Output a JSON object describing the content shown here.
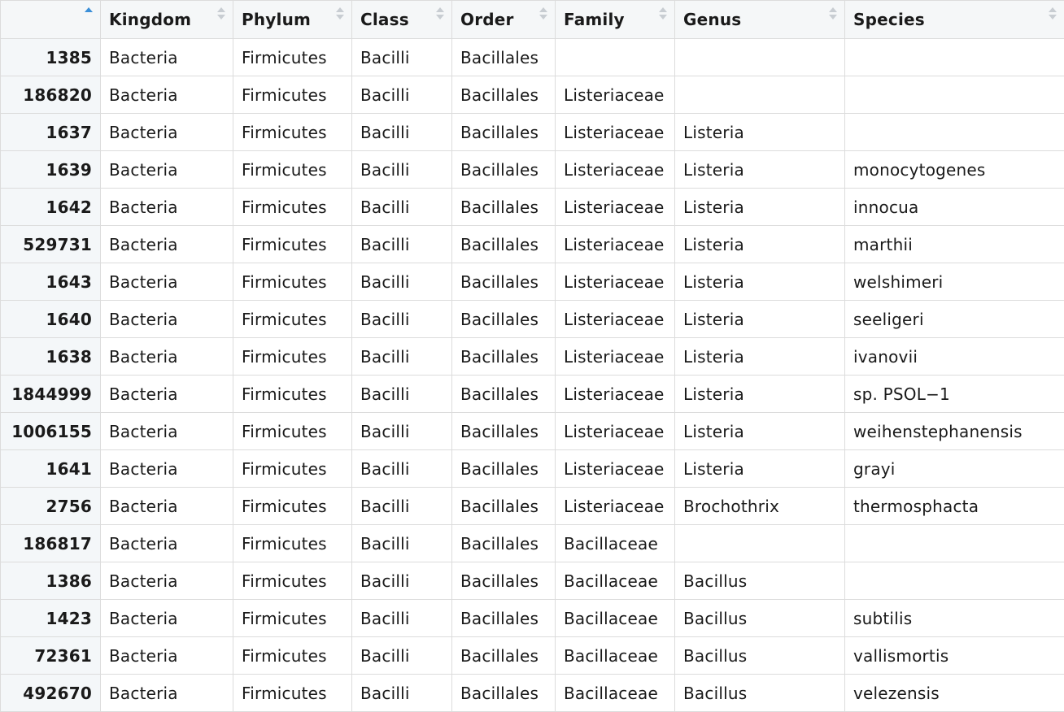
{
  "table": {
    "columns": [
      "",
      "Kingdom",
      "Phylum",
      "Class",
      "Order",
      "Family",
      "Genus",
      "Species"
    ],
    "sorted_column_index": 0,
    "sort_direction": "ascending",
    "rows": [
      [
        "1385",
        "Bacteria",
        "Firmicutes",
        "Bacilli",
        "Bacillales",
        "",
        "",
        ""
      ],
      [
        "186820",
        "Bacteria",
        "Firmicutes",
        "Bacilli",
        "Bacillales",
        "Listeriaceae",
        "",
        ""
      ],
      [
        "1637",
        "Bacteria",
        "Firmicutes",
        "Bacilli",
        "Bacillales",
        "Listeriaceae",
        "Listeria",
        ""
      ],
      [
        "1639",
        "Bacteria",
        "Firmicutes",
        "Bacilli",
        "Bacillales",
        "Listeriaceae",
        "Listeria",
        "monocytogenes"
      ],
      [
        "1642",
        "Bacteria",
        "Firmicutes",
        "Bacilli",
        "Bacillales",
        "Listeriaceae",
        "Listeria",
        "innocua"
      ],
      [
        "529731",
        "Bacteria",
        "Firmicutes",
        "Bacilli",
        "Bacillales",
        "Listeriaceae",
        "Listeria",
        "marthii"
      ],
      [
        "1643",
        "Bacteria",
        "Firmicutes",
        "Bacilli",
        "Bacillales",
        "Listeriaceae",
        "Listeria",
        "welshimeri"
      ],
      [
        "1640",
        "Bacteria",
        "Firmicutes",
        "Bacilli",
        "Bacillales",
        "Listeriaceae",
        "Listeria",
        "seeligeri"
      ],
      [
        "1638",
        "Bacteria",
        "Firmicutes",
        "Bacilli",
        "Bacillales",
        "Listeriaceae",
        "Listeria",
        "ivanovii"
      ],
      [
        "1844999",
        "Bacteria",
        "Firmicutes",
        "Bacilli",
        "Bacillales",
        "Listeriaceae",
        "Listeria",
        "sp. PSOL−1"
      ],
      [
        "1006155",
        "Bacteria",
        "Firmicutes",
        "Bacilli",
        "Bacillales",
        "Listeriaceae",
        "Listeria",
        "weihenstephanensis"
      ],
      [
        "1641",
        "Bacteria",
        "Firmicutes",
        "Bacilli",
        "Bacillales",
        "Listeriaceae",
        "Listeria",
        "grayi"
      ],
      [
        "2756",
        "Bacteria",
        "Firmicutes",
        "Bacilli",
        "Bacillales",
        "Listeriaceae",
        "Brochothrix",
        "thermosphacta"
      ],
      [
        "186817",
        "Bacteria",
        "Firmicutes",
        "Bacilli",
        "Bacillales",
        "Bacillaceae",
        "",
        ""
      ],
      [
        "1386",
        "Bacteria",
        "Firmicutes",
        "Bacilli",
        "Bacillales",
        "Bacillaceae",
        "Bacillus",
        ""
      ],
      [
        "1423",
        "Bacteria",
        "Firmicutes",
        "Bacilli",
        "Bacillales",
        "Bacillaceae",
        "Bacillus",
        "subtilis"
      ],
      [
        "72361",
        "Bacteria",
        "Firmicutes",
        "Bacilli",
        "Bacillales",
        "Bacillaceae",
        "Bacillus",
        "vallismortis"
      ],
      [
        "492670",
        "Bacteria",
        "Firmicutes",
        "Bacilli",
        "Bacillales",
        "Bacillaceae",
        "Bacillus",
        "velezensis"
      ]
    ]
  },
  "colors": {
    "active_sort_arrow": "#3b8fd8",
    "inactive_sort_arrow": "#c8cdd2",
    "header_background": "#f5f7f8",
    "rowname_background": "#f4f7f9",
    "grid_line": "#dcdcdc"
  },
  "icons": {
    "sort_indicator": "sort-arrows-icon"
  }
}
